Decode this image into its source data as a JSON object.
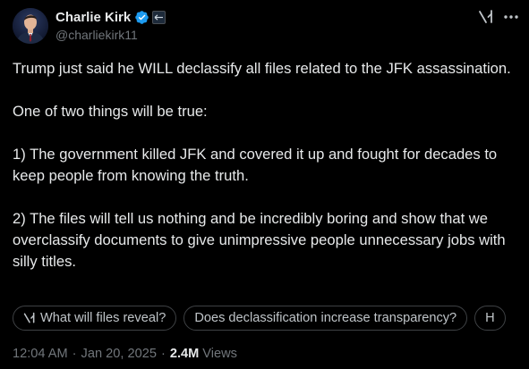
{
  "author": {
    "name": "Charlie Kirk",
    "handle": "@charliekirk11"
  },
  "icons": {
    "verified": "verified-badge-icon",
    "affiliation": "affiliation-badge-icon",
    "grok": "grok-icon",
    "more": "more-icon"
  },
  "colors": {
    "background": "#000000",
    "text": "#e7e9ea",
    "muted": "#71767b",
    "verified_blue": "#1d9bf0",
    "chip_border": "#3e4144"
  },
  "tweet": {
    "paragraphs": [
      "Trump just said he WILL declassify all files related to the JFK assassination.",
      "One of two things will be true:",
      "1) The government killed JFK and covered it up and fought for decades to keep people from knowing the truth.",
      "2) The files will tell us nothing and be incredibly boring and show that we overclassify documents to give unimpressive people unnecessary jobs with silly titles."
    ]
  },
  "chips": [
    {
      "label": "What will files reveal?",
      "has_icon": true
    },
    {
      "label": "Does declassification increase transparency?",
      "has_icon": false
    },
    {
      "label": "H",
      "has_icon": false
    }
  ],
  "meta": {
    "time": "12:04 AM",
    "separator": "·",
    "date": "Jan 20, 2025",
    "views_count": "2.4M",
    "views_label": "Views"
  }
}
